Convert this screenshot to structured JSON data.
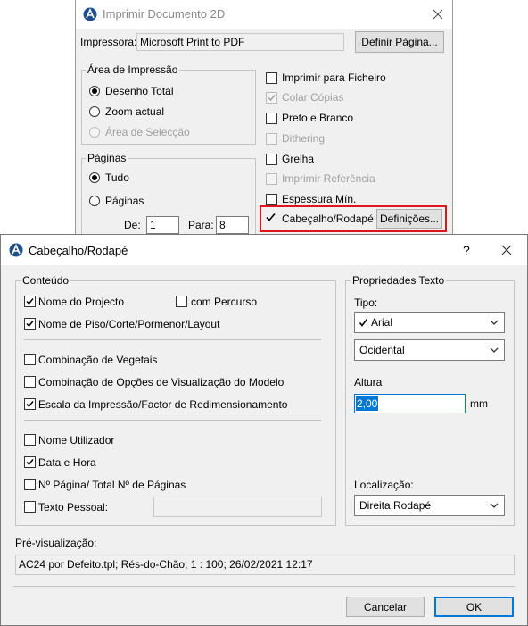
{
  "print_dialog": {
    "title": "Imprimir Documento 2D",
    "printer_label": "Impressora:",
    "printer_value": "Microsoft Print to PDF",
    "page_setup_button": "Definir Página...",
    "print_area": {
      "label": "Área de Impressão",
      "options": [
        "Desenho Total",
        "Zoom actual",
        "Área de Selecção"
      ],
      "selected": "Desenho Total"
    },
    "pages": {
      "label": "Páginas",
      "options": [
        "Tudo",
        "Páginas"
      ],
      "selected": "Tudo",
      "from_label": "De:",
      "from_value": "1",
      "to_label": "Para:",
      "to_value": "8"
    },
    "options": [
      {
        "label": "Imprimir para Ficheiro",
        "checked": false,
        "enabled": true
      },
      {
        "label": "Colar Cópias",
        "checked": true,
        "enabled": false
      },
      {
        "label": "Preto e Branco",
        "checked": false,
        "enabled": true
      },
      {
        "label": "Dithering",
        "checked": false,
        "enabled": false
      },
      {
        "label": "Grelha",
        "checked": false,
        "enabled": true
      },
      {
        "label": "Imprimir Referência",
        "checked": false,
        "enabled": false
      },
      {
        "label": "Espessura Mín.",
        "checked": false,
        "enabled": true
      },
      {
        "label": "Cabeçalho/Rodapé",
        "checked": true,
        "enabled": true
      }
    ],
    "settings_button": "Definições...",
    "highlight_color": "#e0161b"
  },
  "header_footer_dialog": {
    "title": "Cabeçalho/Rodapé",
    "help_label": "?",
    "content": {
      "label": "Conteúdo",
      "project_name": {
        "label": "Nome do Projecto",
        "checked": true
      },
      "with_path": {
        "label": "com Percurso",
        "checked": false
      },
      "floor_name": {
        "label": "Nome de Piso/Corte/Pormenor/Layout",
        "checked": true
      },
      "vegetation": {
        "label": "Combinação de Vegetais",
        "checked": false
      },
      "model_view": {
        "label": "Combinação de Opções de Visualização do Modelo",
        "checked": false
      },
      "scale": {
        "label": "Escala da Impressão/Factor de Redimensionamento",
        "checked": true
      },
      "user_name": {
        "label": "Nome Utilizador",
        "checked": false
      },
      "date_time": {
        "label": "Data e Hora",
        "checked": true
      },
      "page_number": {
        "label": "Nº Página/ Total Nº de Páginas",
        "checked": false
      },
      "custom_text": {
        "label": "Texto Pessoal:",
        "checked": false,
        "value": ""
      }
    },
    "text_properties": {
      "label": "Propriedades Texto",
      "type_label": "Tipo:",
      "font_value": "Arial",
      "charset_value": "Ocidental",
      "height_label": "Altura",
      "height_value": "2,00",
      "height_unit": "mm",
      "location_label": "Localização:",
      "location_value": "Direita Rodapé"
    },
    "preview_label": "Pré-visualização:",
    "preview_text": "AC24 por Defeito.tpl; Rés-do-Chão; 1 : 100; 26/02/2021 12:17",
    "cancel_button": "Cancelar",
    "ok_button": "OK",
    "accent_color": "#0078d7"
  }
}
